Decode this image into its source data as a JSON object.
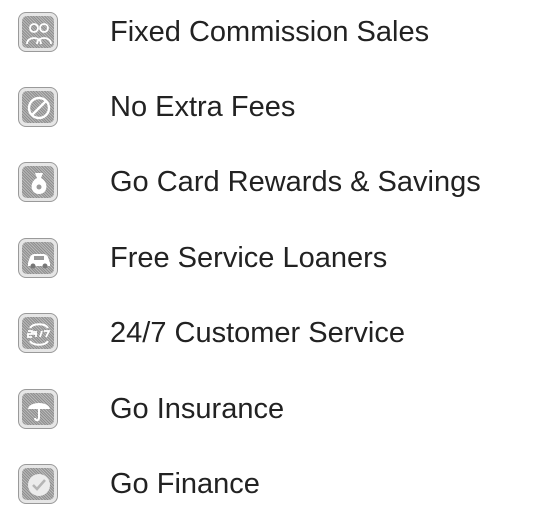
{
  "features": [
    {
      "label": "Fixed Commission Sales",
      "icon": "people-icon"
    },
    {
      "label": "No Extra Fees",
      "icon": "no-fees-icon"
    },
    {
      "label": "Go Card Rewards & Savings",
      "icon": "money-bag-icon"
    },
    {
      "label": "Free Service Loaners",
      "icon": "car-icon"
    },
    {
      "label": "24/7 Customer Service",
      "icon": "24-7-icon"
    },
    {
      "label": "Go Insurance",
      "icon": "umbrella-icon"
    },
    {
      "label": "Go Finance",
      "icon": "checkmark-icon"
    }
  ],
  "colors": {
    "text": "#222222",
    "icon_bg": "#b9b9b9",
    "icon_stroke": "#ffffff"
  }
}
